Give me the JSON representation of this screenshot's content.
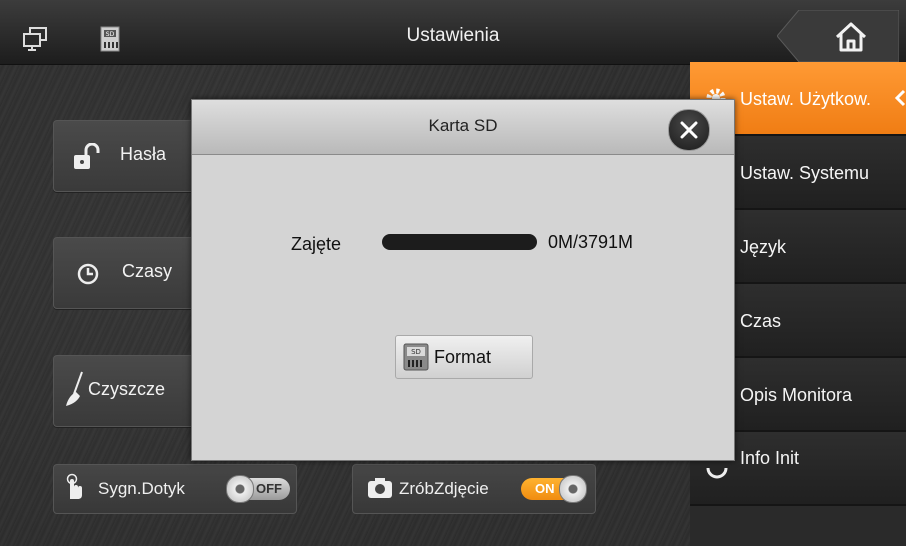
{
  "header": {
    "title": "Ustawienia"
  },
  "tiles": {
    "passwords": "Hasła",
    "times": "Czasy",
    "cleaning": "Czyszcze"
  },
  "bottom": {
    "touch_sound": {
      "label": "Sygn.Dotyk",
      "state": "OFF"
    },
    "take_photo": {
      "label": "ZróbZdjęcie",
      "state": "ON"
    }
  },
  "sidebar": {
    "items": [
      {
        "label": "Ustaw. Użytkow.",
        "active": true
      },
      {
        "label": "Ustaw. Systemu"
      },
      {
        "label": "Język"
      },
      {
        "label": "Czas"
      },
      {
        "label": "Opis Monitora"
      },
      {
        "label": "Info Init"
      }
    ]
  },
  "dialog": {
    "title": "Karta SD",
    "used_label": "Zajęte",
    "used_value": "0M/3791M",
    "format_label": "Format"
  },
  "colors": {
    "accent": "#f58a1f",
    "dialog_bg": "#d4d4d4"
  }
}
